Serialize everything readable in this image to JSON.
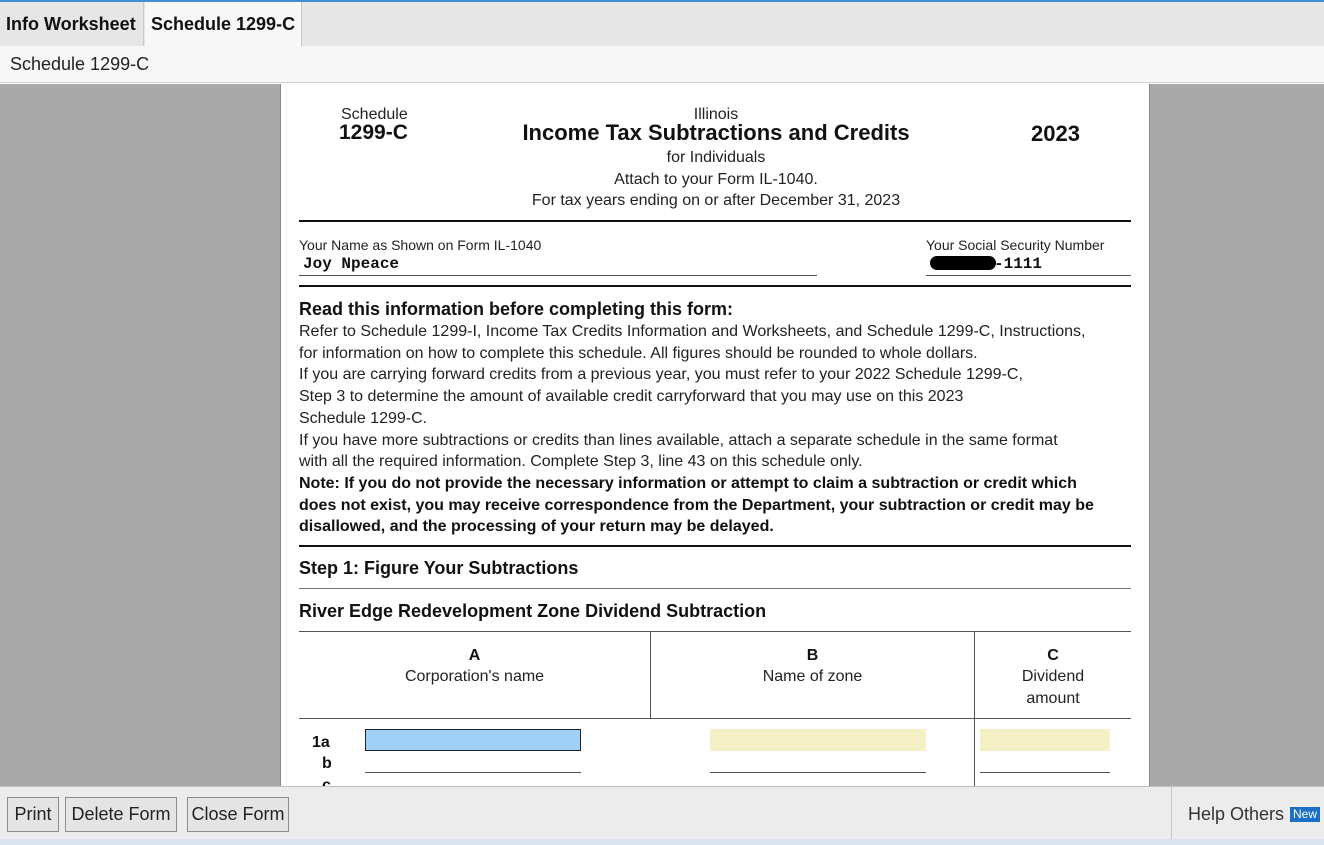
{
  "tabs": [
    {
      "label": "Info Worksheet"
    },
    {
      "label": "Schedule 1299-C"
    }
  ],
  "subtitle": "Schedule 1299-C",
  "form": {
    "schedule_label": "Schedule",
    "schedule_number": "1299-C",
    "state": "Illinois",
    "title": "Income Tax Subtractions and Credits",
    "year": "2023",
    "sub1": "for Individuals",
    "sub2": "Attach to your Form IL-1040.",
    "sub3": "For tax years ending on or after December 31, 2023",
    "name_label": "Your Name as Shown on Form IL-1040",
    "name_value": "Joy Npeace",
    "ssn_label": "Your Social Security Number",
    "ssn_value": "-1111",
    "read_heading": "Read this information before completing this form:",
    "paragraph_lines": [
      "Refer to Schedule 1299-I, Income Tax Credits Information and Worksheets, and Schedule 1299-C, Instructions,",
      "for information on how to complete this schedule. All figures should be rounded to whole dollars.",
      "If you are carrying forward credits from a previous year, you must refer to your 2022 Schedule 1299-C,",
      "Step 3 to determine the amount of available credit carryforward that you may use on this 2023",
      "Schedule 1299-C.",
      "If you have more subtractions or credits than lines available, attach a separate schedule in the same format",
      "with all the required information. Complete Step 3, line 43 on this schedule only."
    ],
    "note_lines": [
      "Note: If you do not provide the necessary information or attempt to claim a subtraction or credit which",
      "does not exist, you may receive correspondence from the Department, your subtraction or credit may be",
      "disallowed, and the processing of your return may be delayed."
    ],
    "step1": "Step 1: Figure Your Subtractions",
    "section": "River Edge Redevelopment Zone Dividend Subtraction",
    "columns": [
      {
        "letter": "A",
        "label": "Corporation's name"
      },
      {
        "letter": "B",
        "label": "Name of zone"
      },
      {
        "letter": "C",
        "label_line1": "Dividend",
        "label_line2": "amount"
      }
    ],
    "row_labels": [
      "1a",
      "b",
      "c"
    ]
  },
  "buttons": {
    "print": "Print",
    "delete": "Delete Form",
    "close": "Close Form"
  },
  "help": {
    "label": "Help Others",
    "badge": "New"
  },
  "colors": {
    "accent": "#3f8fd2",
    "field_active": "#9fd0f8",
    "field_input": "#f5efc6",
    "viewer_bg": "#a9a9a9"
  }
}
